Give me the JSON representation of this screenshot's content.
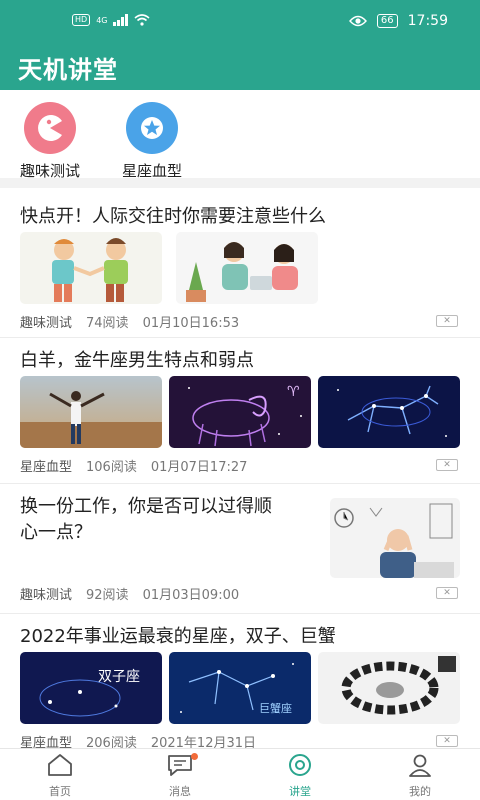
{
  "status": {
    "time": "17:59",
    "battery": "66",
    "hd": "HD",
    "network": "4G"
  },
  "app": {
    "title": "天机讲堂"
  },
  "shortcuts": [
    {
      "label": "趣味测试",
      "icon": "pacman-icon",
      "color": "#f07b8b"
    },
    {
      "label": "星座血型",
      "icon": "star-icon",
      "color": "#4aa3e8"
    }
  ],
  "articles": [
    {
      "title": "快点开！人际交往时你需要注意些什么",
      "category": "趣味测试",
      "reads": "74阅读",
      "time": "01月10日16:53"
    },
    {
      "title": "白羊，金牛座男生特点和弱点",
      "category": "星座血型",
      "reads": "106阅读",
      "time": "01月07日17:27"
    },
    {
      "title_line1": "换一份工作，你是否可以过得顺",
      "title_line2": "心一点？",
      "category": "趣味测试",
      "reads": "92阅读",
      "time": "01月03日09:00"
    },
    {
      "title": "2022年事业运最衰的星座，双子、巨蟹",
      "category": "星座血型",
      "reads": "206阅读",
      "time": "2021年12月31日",
      "image_text1": "双子座",
      "image_text2": "巨蟹座"
    }
  ],
  "tabs": [
    {
      "label": "首页",
      "icon": "home-icon"
    },
    {
      "label": "消息",
      "icon": "message-icon"
    },
    {
      "label": "讲堂",
      "icon": "lecture-icon"
    },
    {
      "label": "我的",
      "icon": "profile-icon"
    }
  ],
  "colors": {
    "accent": "#2aa58e",
    "badge": "#f26b3a"
  }
}
